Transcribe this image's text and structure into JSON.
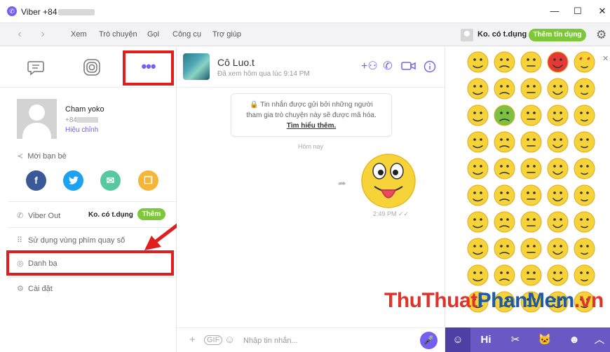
{
  "window": {
    "title": "Viber +84",
    "minimize": "—",
    "maximize": "☐",
    "close": "✕"
  },
  "menu": {
    "items": [
      "Xem",
      "Trò chuyện",
      "Gọi",
      "Công cụ",
      "Trợ giúp"
    ],
    "account_status": "Ko. có t.dụng",
    "credit_button": "Thêm tín dụng"
  },
  "left_panel": {
    "top_icons": [
      "chat-icon",
      "stories-icon",
      "more-icon"
    ],
    "more_label": "•••",
    "profile": {
      "name": "Cham yoko",
      "phone": "+84",
      "edit": "Hiệu chỉnh"
    },
    "invite": "Mời bạn bè",
    "social_icons": [
      "facebook-icon",
      "twitter-icon",
      "email-icon",
      "copy-icon"
    ],
    "viber_out": {
      "label": "Viber Out",
      "status": "Ko. có t.dụng",
      "button": "Thêm"
    },
    "keypad": "Sử dụng vùng phím quay số",
    "contacts": "Danh bạ",
    "settings": "Cài đặt"
  },
  "chat": {
    "contact_name": "Cô Luo.t",
    "last_seen": "Đã xem hôm qua lúc 9:14 PM",
    "notice_line1": "🔒 Tin nhắn được gửi bởi những người",
    "notice_line2": "tham gia trò chuyện này sẽ được mã hóa.",
    "notice_link": "Tìm hiểu thêm.",
    "day_label": "Hôm nay",
    "message_time": "2:49 PM ✓✓",
    "composer_placeholder": "Nhập tin nhắn..."
  },
  "emoji_panel": {
    "close": "✕",
    "tabs": [
      "smiley-icon",
      "hi-icon",
      "sticker-icon",
      "cat-icon",
      "face-icon",
      "expand-icon"
    ],
    "tab_labels": [
      "☺",
      "Hi",
      "✂",
      "🐱",
      "☻",
      "︿"
    ]
  },
  "watermark": {
    "part1": "ThuThuat",
    "part2": "PhanMem",
    "part3": ".vn"
  },
  "colors": {
    "accent": "#7360f2",
    "green": "#7ec63a",
    "highlight_red": "#e01e1e",
    "emoji_yellow": "#f7d33a"
  }
}
